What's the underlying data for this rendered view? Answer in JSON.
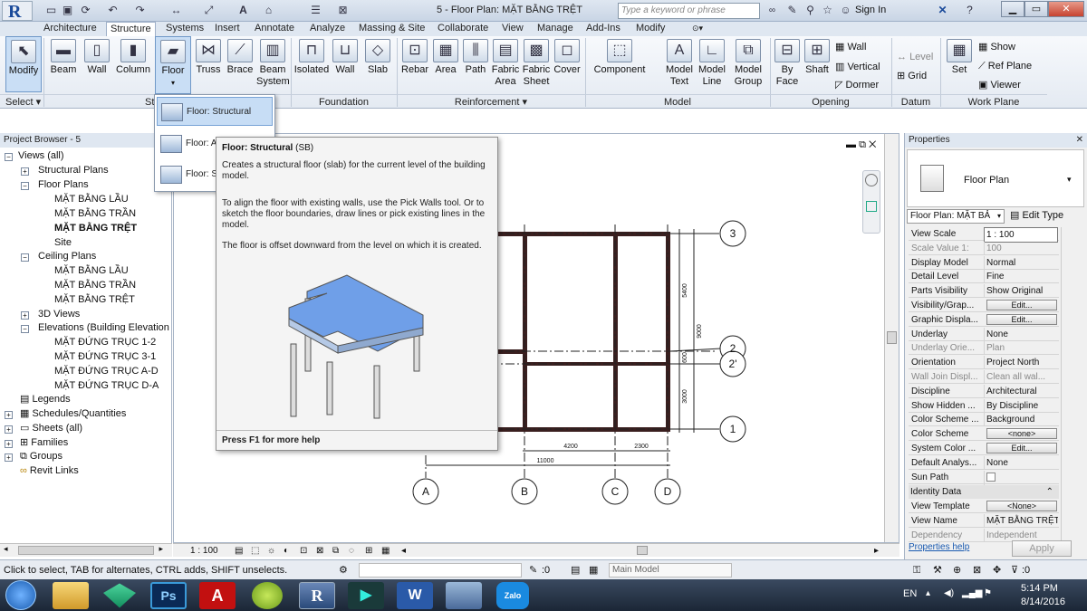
{
  "titlebar": {
    "doc_title": "5 - Floor Plan: MẶT BẰNG TRỆT",
    "search_placeholder": "Type a keyword or phrase",
    "sign_in": "Sign In"
  },
  "tabs": [
    "Architecture",
    "Structure",
    "Systems",
    "Insert",
    "Annotate",
    "Analyze",
    "Massing & Site",
    "Collaborate",
    "View",
    "Manage",
    "Add-Ins",
    "Modify"
  ],
  "active_tab": "Structure",
  "ribbon": {
    "buttons": {
      "modify": "Modify",
      "beam": "Beam",
      "wall": "Wall",
      "column": "Column",
      "floor": "Floor",
      "truss": "Truss",
      "brace": "Brace",
      "beam_system": "Beam System",
      "isolated": "Isolated",
      "wall_f": "Wall",
      "slab": "Slab",
      "rebar": "Rebar",
      "area": "Area",
      "path": "Path",
      "fabric_area": "Fabric Area",
      "fabric_sheet": "Fabric Sheet",
      "cover": "Cover",
      "component": "Component",
      "model_text": "Model Text",
      "model_line": "Model Line",
      "model_group": "Model Group",
      "by_face": "By Face",
      "shaft": "Shaft",
      "wall_o": "Wall",
      "vertical": "Vertical",
      "dormer": "Dormer",
      "level": "Level",
      "grid": "Grid",
      "set": "Set",
      "show": "Show",
      "ref_plane": "Ref Plane",
      "viewer": "Viewer"
    },
    "panels": {
      "select": "Select",
      "structure": "Str",
      "foundation": "Foundation",
      "reinforcement": "Reinforcement",
      "model": "Model",
      "opening": "Opening",
      "datum": "Datum",
      "work_plane": "Work Plane"
    }
  },
  "floor_dropdown": {
    "items": [
      "Floor: Structural",
      "Floor: A",
      "Floor: S"
    ]
  },
  "tooltip": {
    "title": "Floor: Structural",
    "shortcut": "(SB)",
    "p1": "Creates a structural floor (slab) for the current level of the building model.",
    "p2": "To align the floor with existing walls, use the Pick Walls tool. Or to sketch the floor boundaries, draw lines or pick existing lines in the model.",
    "p3": "The floor is offset downward from the level on which it is created.",
    "footer": "Press F1 for more help"
  },
  "project_browser": {
    "header": "Project Browser - 5",
    "items": {
      "views_all": "Views (all)",
      "structural_plans": "Structural Plans",
      "floor_plans": "Floor Plans",
      "fp1": "MẶT BẰNG LẦU",
      "fp2": "MẶT BẰNG TRẦN",
      "fp3": "MẶT BẰNG TRỆT",
      "site": "Site",
      "ceiling_plans": "Ceiling Plans",
      "cp1": "MẶT BẰNG LẦU",
      "cp2": "MẶT BẰNG TRẦN",
      "cp3": "MẶT BẰNG TRỆT",
      "views_3d": "3D Views",
      "elevations": "Elevations (Building Elevation",
      "el1": "MẶT ĐỨNG TRỤC 1-2",
      "el2": "MẶT ĐỨNG TRỤC 3-1",
      "el3": "MẶT ĐỨNG TRỤC A-D",
      "el4": "MẶT ĐỨNG TRỤC D-A",
      "legends": "Legends",
      "schedules": "Schedules/Quantities",
      "sheets": "Sheets (all)",
      "families": "Families",
      "groups": "Groups",
      "revit_links": "Revit Links"
    }
  },
  "drawing": {
    "grid_bubbles": {
      "g3": "3",
      "g2a": "2",
      "g2b": "2'",
      "g1": "1",
      "gA": "A",
      "gB": "B",
      "gC": "C",
      "gD": "D"
    },
    "dims": {
      "d5400": "5400",
      "d9000": "9000",
      "d600": "600",
      "d3000": "3000",
      "d4200": "4200",
      "d2300": "2300",
      "d11000": "11000"
    }
  },
  "view_control_bar": {
    "scale": "1 : 100"
  },
  "properties": {
    "header": "Properties",
    "type_name": "Floor Plan",
    "selector": "Floor Plan: MẶT BẢ",
    "edit_type": "Edit Type",
    "rows": [
      {
        "k": "View Scale",
        "v": "1 : 100",
        "dim": false
      },
      {
        "k": "Scale Value  1:",
        "v": "100",
        "dim": true
      },
      {
        "k": "Display Model",
        "v": "Normal",
        "dim": false
      },
      {
        "k": "Detail Level",
        "v": "Fine",
        "dim": false
      },
      {
        "k": "Parts Visibility",
        "v": "Show Original",
        "dim": false
      },
      {
        "k": "Visibility/Grap...",
        "v": "Edit...",
        "dim": false,
        "button": true
      },
      {
        "k": "Graphic Displa...",
        "v": "Edit...",
        "dim": false,
        "button": true
      },
      {
        "k": "Underlay",
        "v": "None",
        "dim": false
      },
      {
        "k": "Underlay Orie...",
        "v": "Plan",
        "dim": true
      },
      {
        "k": "Orientation",
        "v": "Project North",
        "dim": false
      },
      {
        "k": "Wall Join Displ...",
        "v": "Clean all wal...",
        "dim": true
      },
      {
        "k": "Discipline",
        "v": "Architectural",
        "dim": false
      },
      {
        "k": "Show Hidden ...",
        "v": "By Discipline",
        "dim": false
      },
      {
        "k": "Color Scheme ...",
        "v": "Background",
        "dim": false
      },
      {
        "k": "Color Scheme",
        "v": "<none>",
        "dim": false,
        "button": true
      },
      {
        "k": "System Color ...",
        "v": "Edit...",
        "dim": false,
        "button": true
      },
      {
        "k": "Default Analys...",
        "v": "None",
        "dim": false
      },
      {
        "k": "Sun Path",
        "v": "",
        "dim": false
      }
    ],
    "identity_header": "Identity Data",
    "identity_rows": [
      {
        "k": "View Template",
        "v": "<None>",
        "button": true
      },
      {
        "k": "View Name",
        "v": "MẶT BẰNG TRỆT"
      },
      {
        "k": "Dependency",
        "v": "Independent",
        "dim": true
      }
    ],
    "help_link": "Properties help",
    "apply": "Apply"
  },
  "status": {
    "text": "Click to select, TAB for alternates, CTRL adds, SHIFT unselects.",
    "zero": ":0",
    "workset": "Main Model",
    "filter_count": ":0"
  },
  "taskbar": {
    "lang": "EN",
    "time": "5:14 PM",
    "date": "8/14/2016",
    "zalo": "Zalo"
  },
  "colors": {
    "ribbon_bg": "#e4eaf2",
    "selected": "#c9def5",
    "slab": "#6f9fe8",
    "wall": "#3a1f1f"
  }
}
